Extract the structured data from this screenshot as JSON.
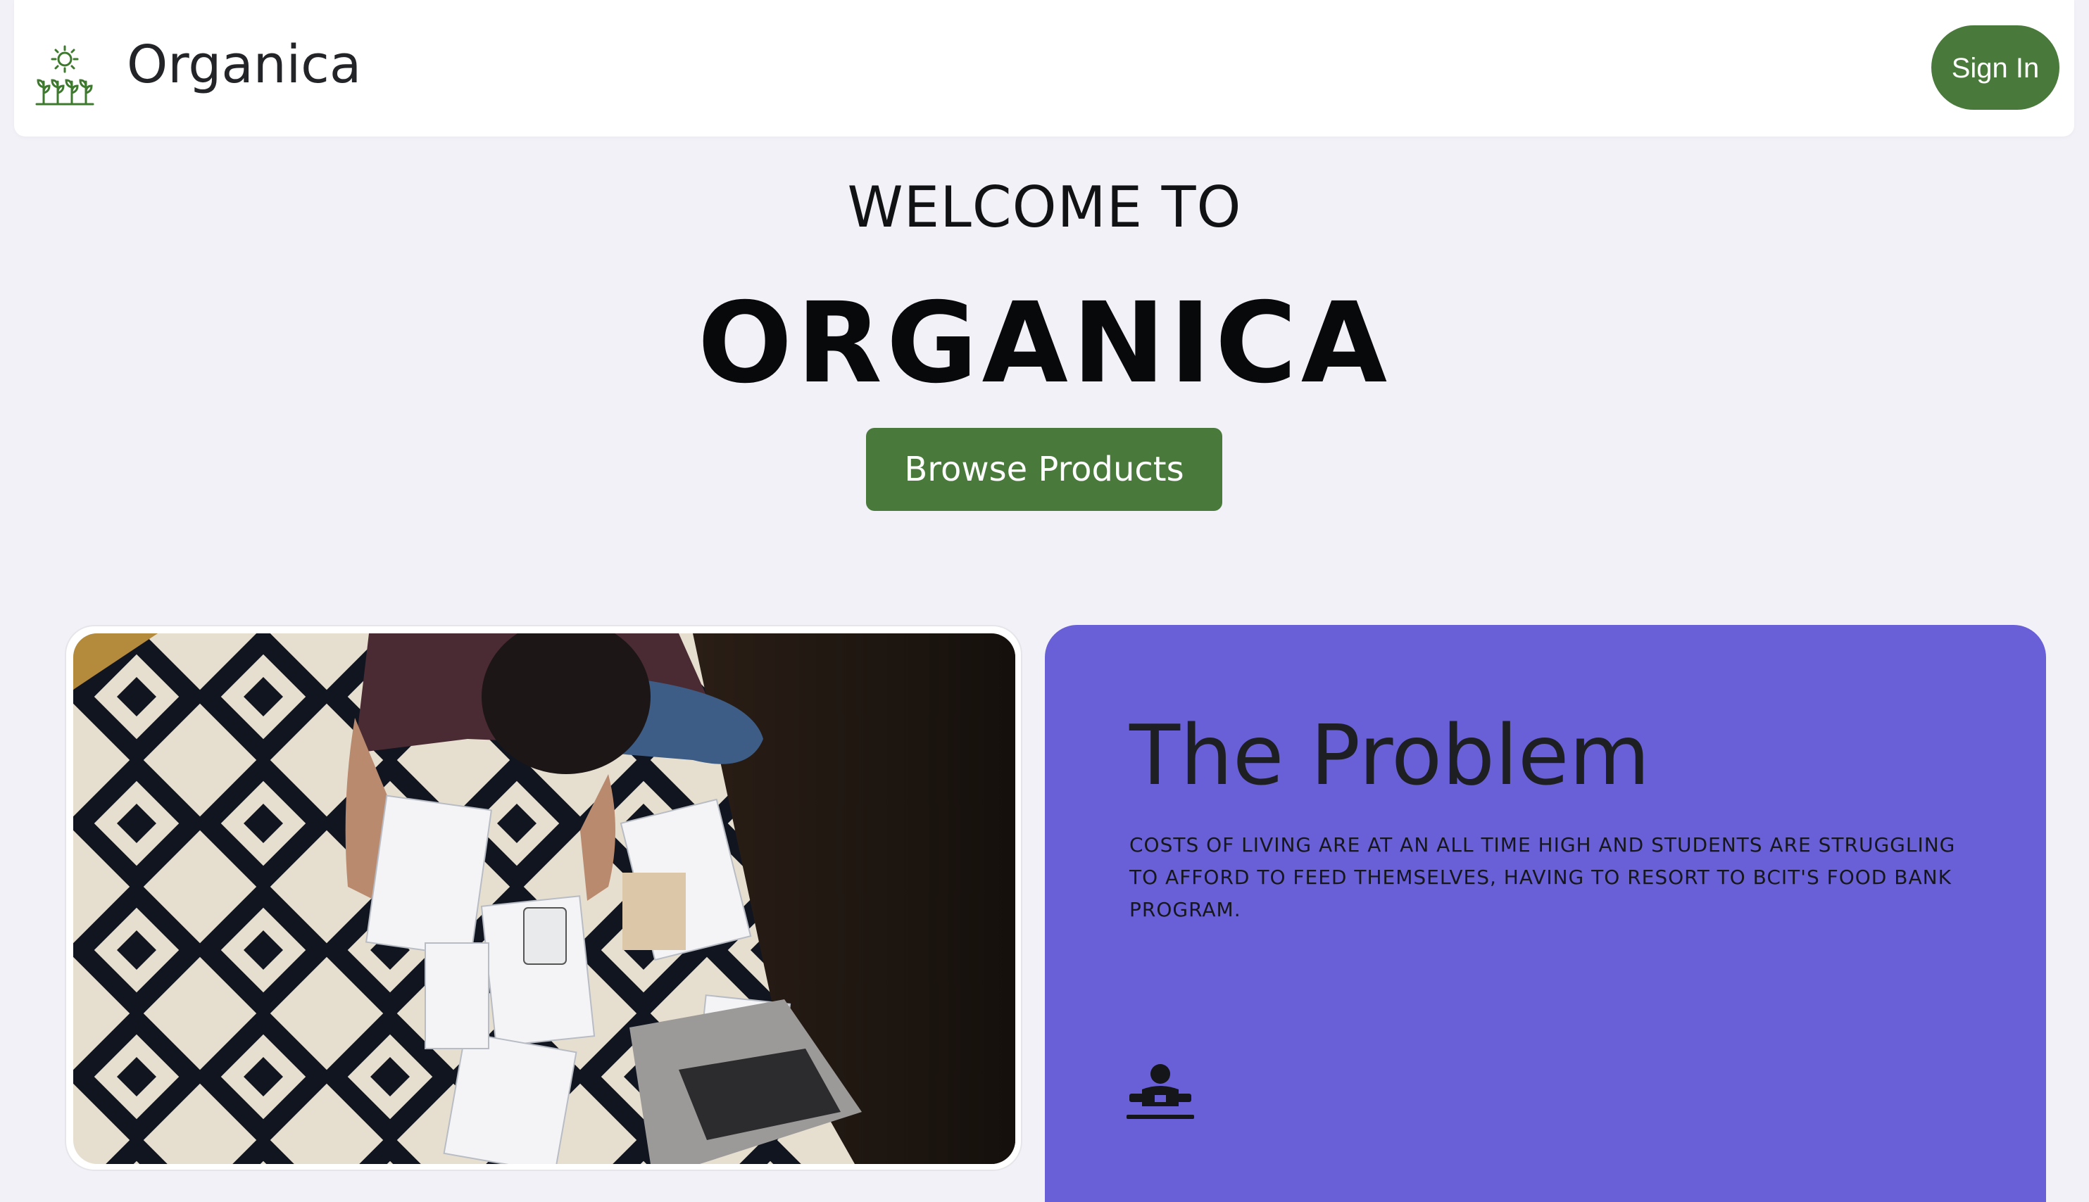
{
  "header": {
    "brand": "Organica",
    "sign_in_label": "Sign In"
  },
  "hero": {
    "kicker": "WELCOME TO",
    "title": "ORGANICA",
    "browse_label": "Browse Products"
  },
  "problem": {
    "title": "The Problem",
    "body": "Costs of living are at an all time high and students are struggling to afford to feed themselves, having to resort to BCIT's food bank program."
  },
  "icons": {
    "logo": "sun-plants-icon",
    "problem": "person-with-bills-icon"
  },
  "colors": {
    "accent_green": "#4a7a3b",
    "problem_bg": "#6960d8",
    "page_bg": "#f2f1f7"
  }
}
